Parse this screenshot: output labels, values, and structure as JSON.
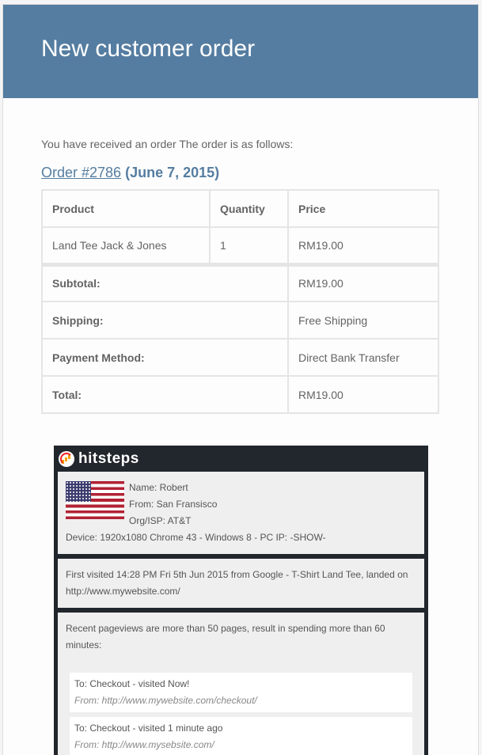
{
  "header": {
    "title": "New customer order"
  },
  "intro": "You have received an order The order is as follows:",
  "order": {
    "link_text": "Order #2786",
    "date": "(June 7, 2015)"
  },
  "table": {
    "headers": [
      "Product",
      "Quantity",
      "Price"
    ],
    "rows": [
      {
        "product": "Land Tee Jack & Jones",
        "quantity": "1",
        "price": "RM19.00"
      }
    ],
    "totals": [
      {
        "label": "Subtotal:",
        "value": "RM19.00"
      },
      {
        "label": "Shipping:",
        "value": "Free Shipping"
      },
      {
        "label": "Payment Method:",
        "value": "Direct Bank Transfer"
      },
      {
        "label": "Total:",
        "value": "RM19.00"
      }
    ]
  },
  "hitsteps": {
    "brand": "hitsteps",
    "visitor": {
      "name": "Name: Robert",
      "from": "From: San Fransisco",
      "isp": "Org/ISP: AT&T",
      "device": "Device: 1920x1080 Chrome 43 - Windows 8 - PC IP: -SHOW-"
    },
    "first_visit": "First visited 14:28 PM Fri 5th Jun 2015 from Google - T-Shirt Land Tee, landed on http://www.mywebsite.com/",
    "recent": "Recent pageviews are more than 50 pages, result in spending more than 60 minutes:",
    "pageviews": [
      {
        "to": "To: Checkout - visited Now!",
        "from": "From: http://www.mywebsite.com/checkout/"
      },
      {
        "to": "To: Checkout  - visited 1 minute ago",
        "from": "From: http://www.mysebsite.com/"
      }
    ]
  }
}
